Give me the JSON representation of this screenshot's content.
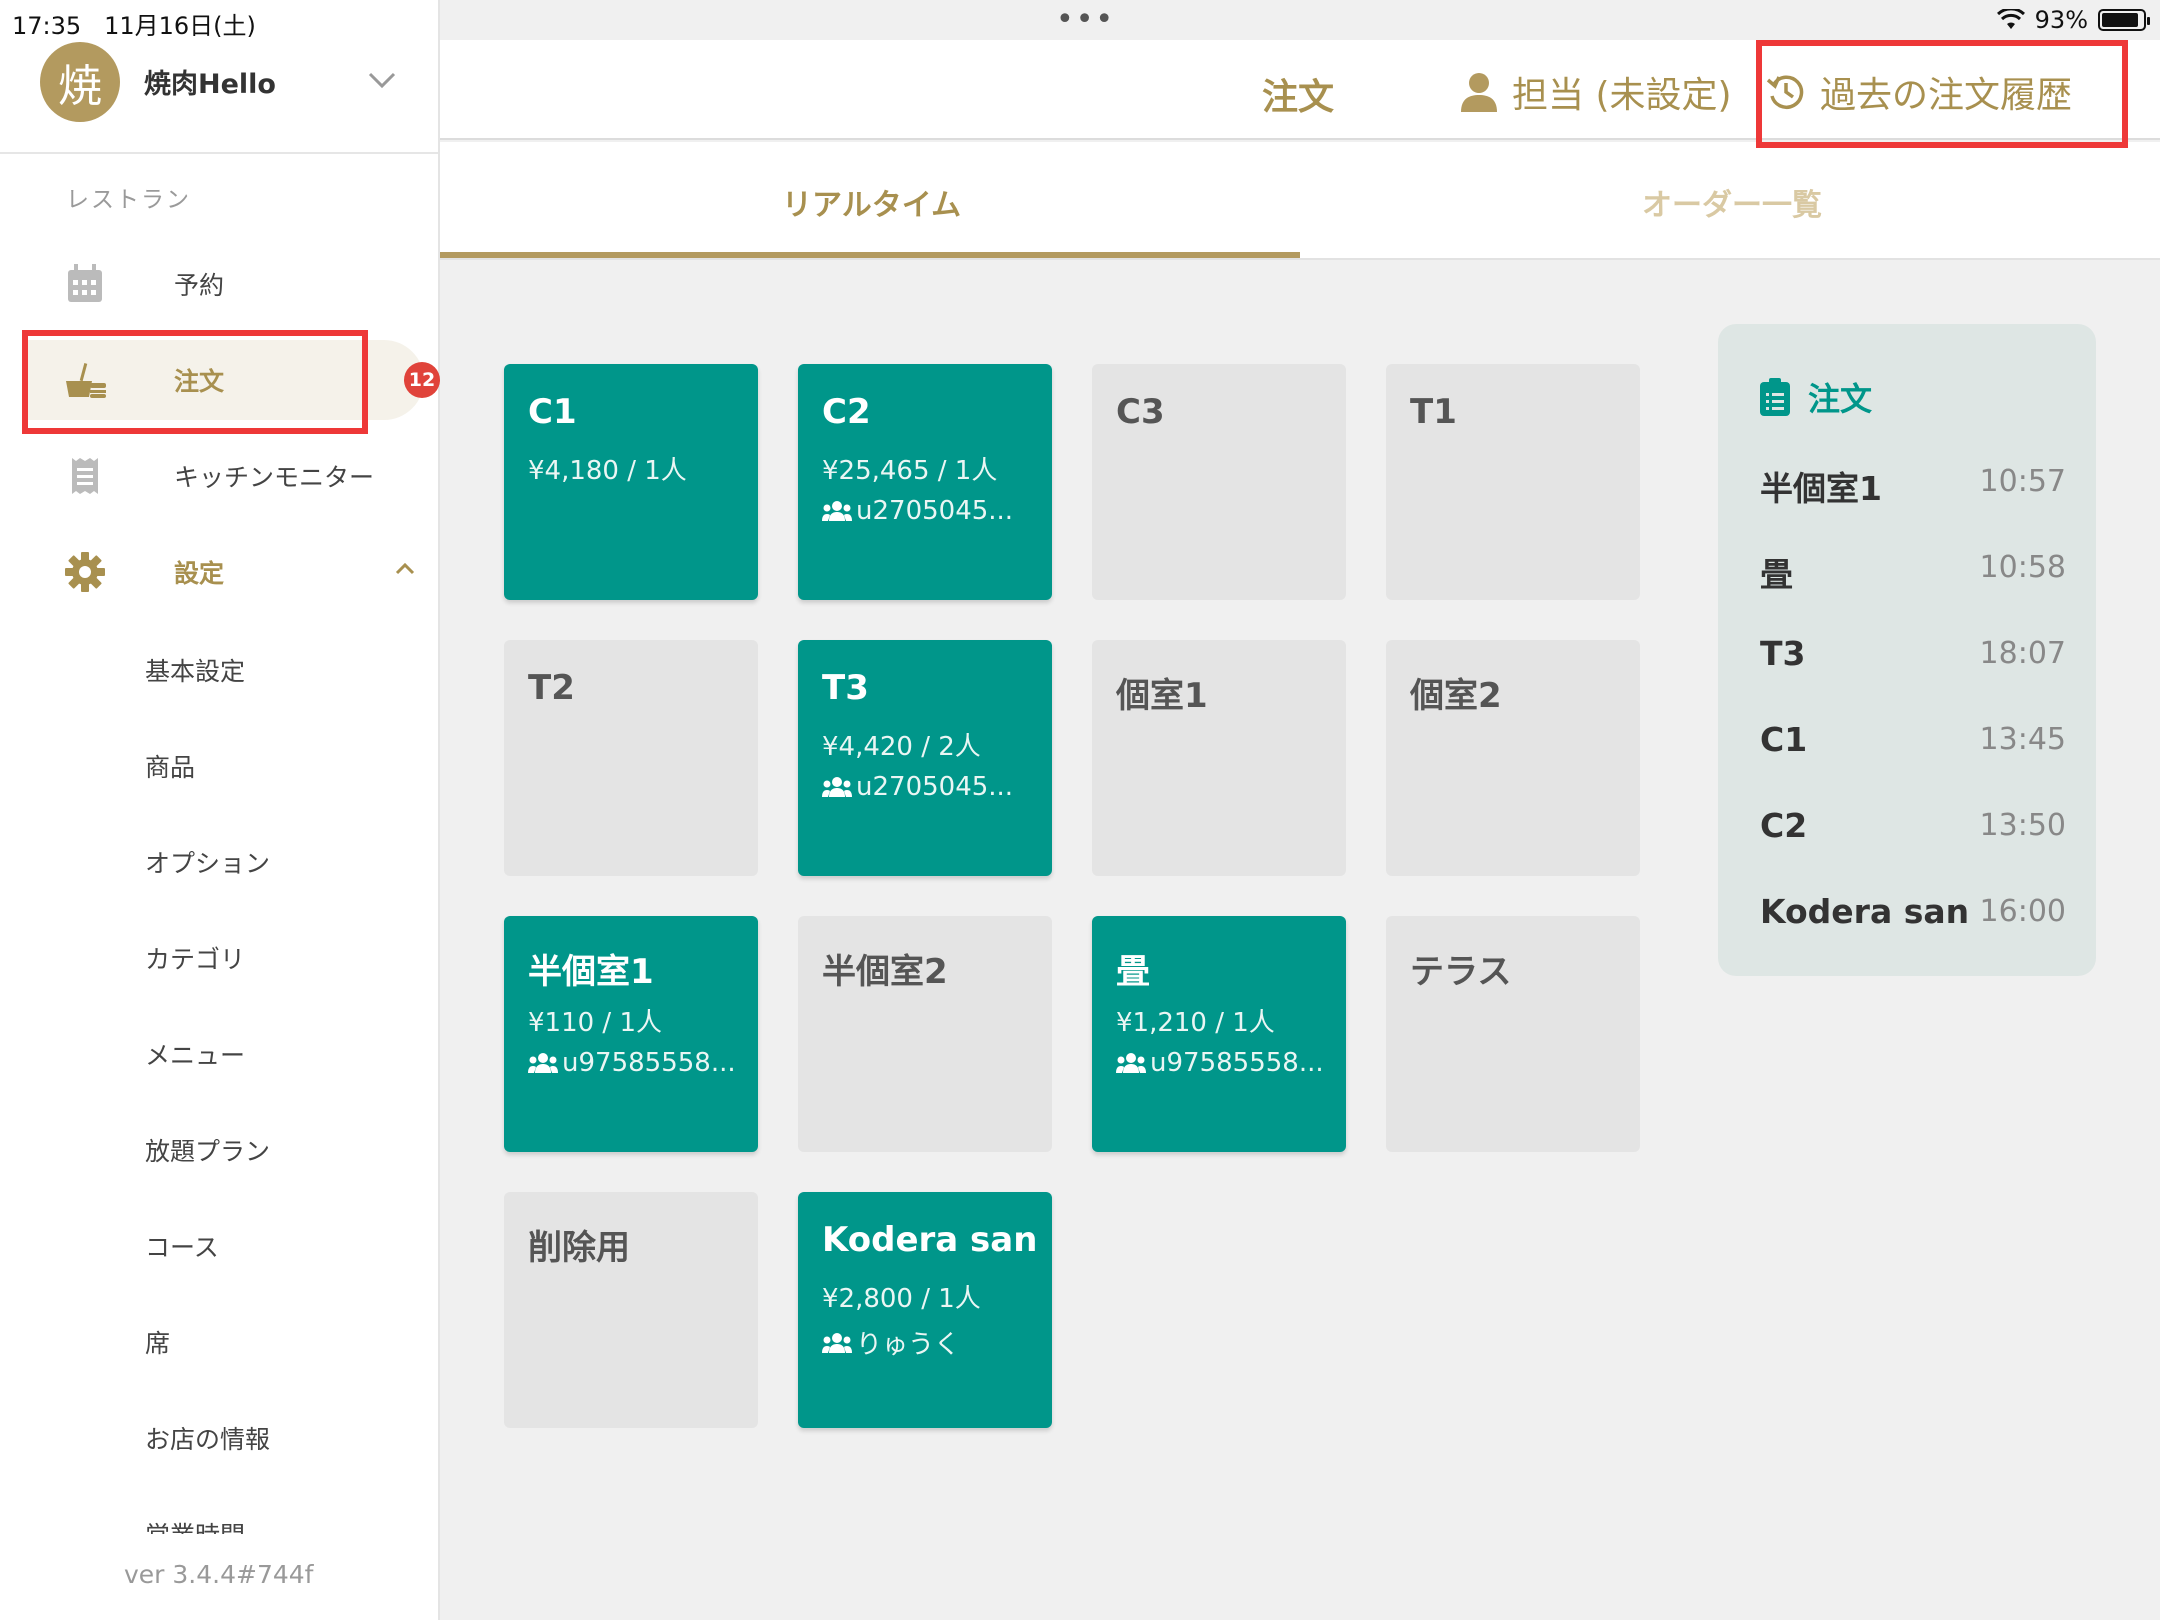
{
  "status": {
    "time": "17:35",
    "date": "11月16日(土)",
    "battery": "93%"
  },
  "store": {
    "avatar_char": "焼",
    "name": "焼肉Hello"
  },
  "sidebar": {
    "section": "レストラン",
    "items": [
      {
        "label": "予約",
        "icon": "calendar-icon"
      },
      {
        "label": "注文",
        "icon": "food-order-icon",
        "badge": "12"
      },
      {
        "label": "キッチンモニター",
        "icon": "receipt-icon"
      },
      {
        "label": "設定",
        "icon": "gear-icon"
      }
    ],
    "settings_sub": [
      "基本設定",
      "商品",
      "オプション",
      "カテゴリ",
      "メニュー",
      "放題プラン",
      "コース",
      "席",
      "お店の情報"
    ],
    "cutoff_item": "営業時間",
    "version": "ver 3.4.4#744f"
  },
  "header": {
    "title": "注文",
    "staff": "担当 (未設定)",
    "history": "過去の注文履歴"
  },
  "tabs": {
    "realtime": "リアルタイム",
    "list": "オーダー一覧"
  },
  "tables": [
    {
      "name": "C1",
      "active": true,
      "price": "¥4,180 / 1人",
      "guest": ""
    },
    {
      "name": "C2",
      "active": true,
      "price": "¥25,465 / 1人",
      "guest": "u2705045..."
    },
    {
      "name": "C3",
      "active": false
    },
    {
      "name": "T1",
      "active": false
    },
    {
      "name": "T2",
      "active": false
    },
    {
      "name": "T3",
      "active": true,
      "price": "¥4,420 / 2人",
      "guest": "u2705045..."
    },
    {
      "name": "個室1",
      "active": false
    },
    {
      "name": "個室2",
      "active": false
    },
    {
      "name": "半個室1",
      "active": true,
      "price": "¥110 / 1人",
      "guest": "u97585558..."
    },
    {
      "name": "半個室2",
      "active": false
    },
    {
      "name": "畳",
      "active": true,
      "price": "¥1,210 / 1人",
      "guest": "u97585558..."
    },
    {
      "name": "テラス",
      "active": false
    },
    {
      "name": "削除用",
      "active": false
    },
    {
      "name": "Kodera san",
      "active": true,
      "price": "¥2,800 / 1人",
      "guest": "りゅうく"
    }
  ],
  "orders": {
    "title": "注文",
    "rows": [
      {
        "name": "半個室1",
        "time": "10:57"
      },
      {
        "name": "畳",
        "time": "10:58"
      },
      {
        "name": "T3",
        "time": "18:07"
      },
      {
        "name": "C1",
        "time": "13:45"
      },
      {
        "name": "C2",
        "time": "13:50"
      },
      {
        "name": "Kodera san",
        "time": "16:00"
      }
    ]
  },
  "colors": {
    "gold": "#a8904f",
    "teal": "#00968a",
    "highlight_red": "#ee3838",
    "badge_red": "#e0433a"
  }
}
